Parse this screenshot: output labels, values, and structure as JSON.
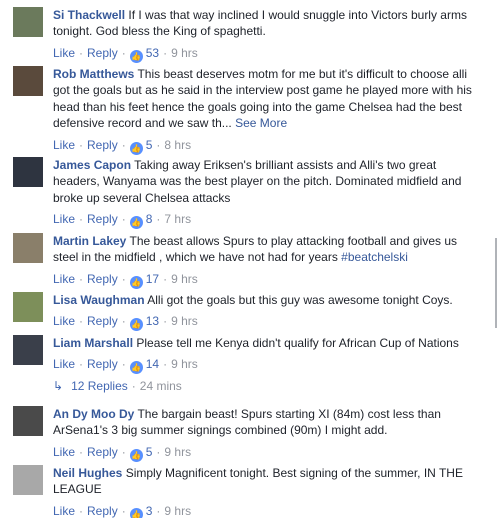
{
  "labels": {
    "like": "Like",
    "reply": "Reply",
    "like_icon": "👍",
    "dot": "·"
  },
  "comments": [
    {
      "author": "Si Thackwell",
      "text": "If I was that way inclined I would snuggle into Victors burly arms tonight. God bless the King of spaghetti.",
      "likes": "53",
      "time": "9 hrs",
      "avatar_color": "#6b7a5c",
      "avatar_icon": "person-avatar"
    },
    {
      "author": "Rob Matthews",
      "text": "This beast deserves motm for me but it's difficult to choose alli got the goals but as he said in the interview post game he played more with his head than his feet hence the goals going into the game Chelsea had the best defensive record and we saw th...",
      "see_more": "See More",
      "likes": "5",
      "time": "8 hrs",
      "avatar_color": "#5a4a3c",
      "avatar_icon": "person-avatar"
    },
    {
      "author": "James Capon",
      "text": "Taking away Eriksen's brilliant assists and Alli's two great headers, Wanyama was the best player on the pitch. Dominated midfield and broke up several Chelsea attacks",
      "likes": "8",
      "time": "7 hrs",
      "avatar_color": "#2e3440",
      "avatar_icon": "person-avatar"
    },
    {
      "author": "Martin Lakey",
      "text": "The beast allows Spurs to play attacking football and gives us steel in the midfield , which we have not had for years",
      "hashtag": "#beatchelski",
      "likes": "17",
      "time": "9 hrs",
      "avatar_color": "#8a7f6a",
      "avatar_icon": "person-avatar"
    },
    {
      "author": "Lisa Waughman",
      "text": "Alli got the goals but this guy was awesome tonight Coys.",
      "likes": "13",
      "time": "9 hrs",
      "avatar_color": "#7d8f5a",
      "avatar_icon": "tree-avatar"
    },
    {
      "author": "Liam Marshall",
      "text": "Please tell me Kenya didn't qualify for African Cup of Nations",
      "likes": "14",
      "time": "9 hrs",
      "avatar_color": "#3a3f4a",
      "avatar_icon": "person-avatar"
    },
    {
      "author": "An Dy Moo Dy",
      "text": "The bargain beast! Spurs starting XI (84m) cost less than ArSena1's 3 big summer signings combined (90m) I might add.",
      "likes": "5",
      "time": "9 hrs",
      "avatar_color": "#4a4a4a",
      "avatar_icon": "person-avatar"
    },
    {
      "author": "Neil Hughes",
      "text": "Simply Magnificent tonight. Best signing of the summer, IN THE LEAGUE",
      "likes": "3",
      "time": "9 hrs",
      "avatar_color": "#a8a8a8",
      "avatar_icon": "person-avatar"
    }
  ],
  "replies_link": {
    "label": "12 Replies",
    "time": "24 mins"
  },
  "colors": {
    "link_blue": "#365899",
    "action_blue": "#4267b2",
    "meta_gray": "#90949c",
    "like_icon_blue": "#5890ff"
  }
}
